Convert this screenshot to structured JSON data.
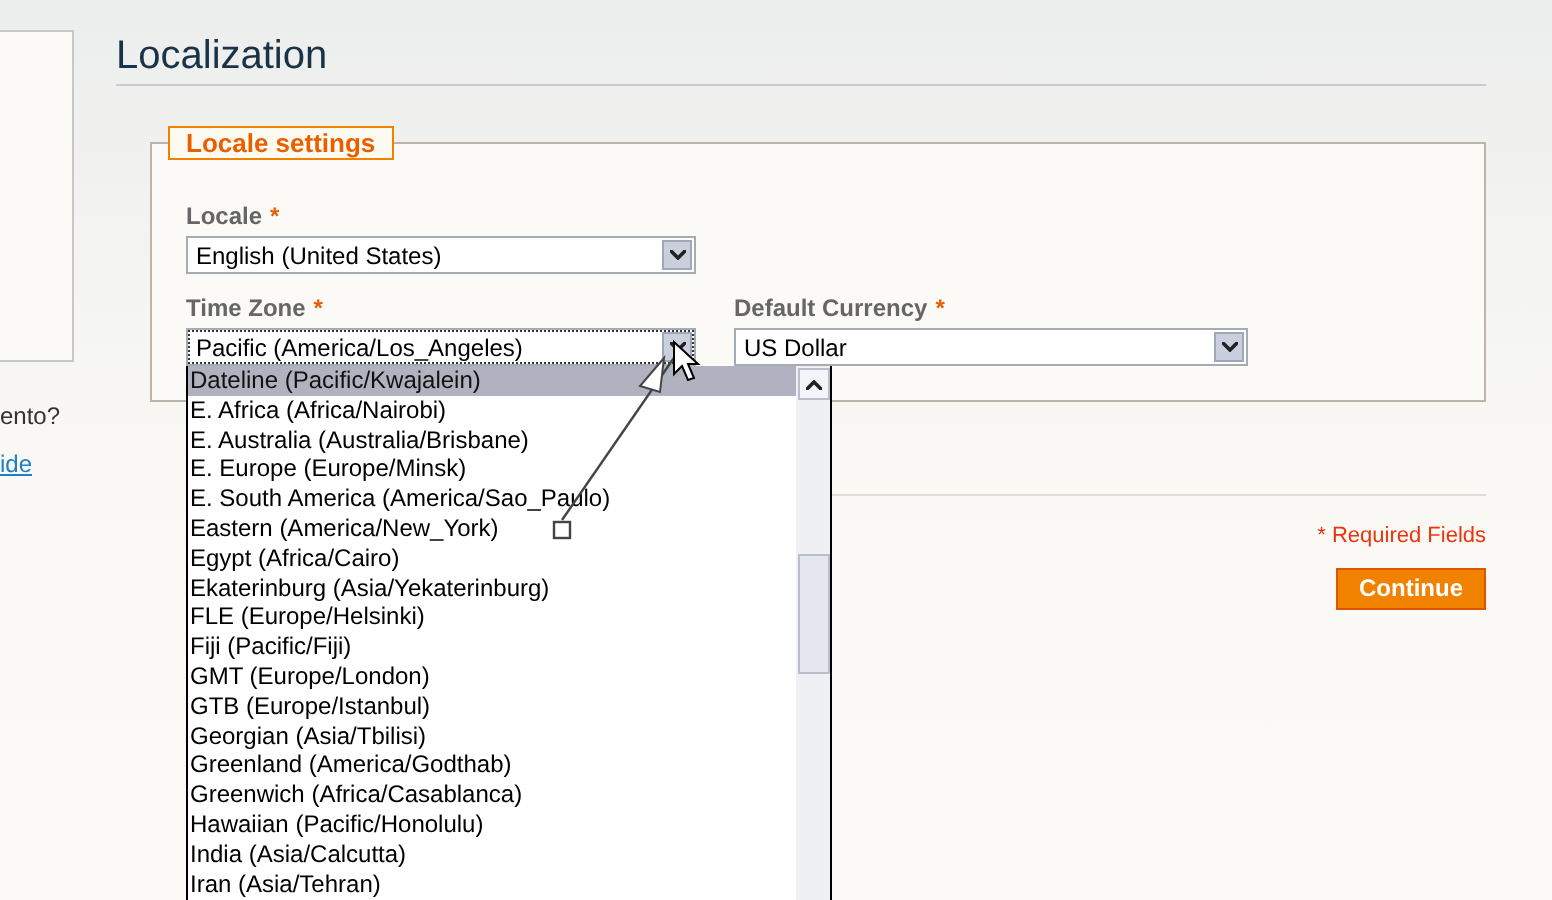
{
  "sidebar": {
    "texts": [
      {
        "text": "ento?",
        "kind": "text"
      },
      {
        "text": "ide",
        "kind": "link"
      }
    ]
  },
  "page": {
    "title": "Localization"
  },
  "fieldset": {
    "legend": "Locale settings",
    "fields": [
      {
        "label": "Locale",
        "mark": "*",
        "value": "English (United States)",
        "expanded": false
      },
      {
        "label": "Time Zone",
        "mark": "*",
        "value": "Pacific (America/Los_Angeles)",
        "expanded": true,
        "options": [
          {
            "label": "Dateline (Pacific/Kwajalein)",
            "selected": true
          },
          {
            "label": "E. Africa (Africa/Nairobi)",
            "selected": false
          },
          {
            "label": "E. Australia (Australia/Brisbane)",
            "selected": false
          },
          {
            "label": "E. Europe (Europe/Minsk)",
            "selected": false
          },
          {
            "label": "E. South America (America/Sao_Paulo)",
            "selected": false
          },
          {
            "label": "Eastern (America/New_York)",
            "selected": false
          },
          {
            "label": "Egypt (Africa/Cairo)",
            "selected": false
          },
          {
            "label": "Ekaterinburg (Asia/Yekaterinburg)",
            "selected": false
          },
          {
            "label": "FLE (Europe/Helsinki)",
            "selected": false
          },
          {
            "label": "Fiji (Pacific/Fiji)",
            "selected": false
          },
          {
            "label": "GMT (Europe/London)",
            "selected": false
          },
          {
            "label": "GTB (Europe/Istanbul)",
            "selected": false
          },
          {
            "label": "Georgian (Asia/Tbilisi)",
            "selected": false
          },
          {
            "label": "Greenland (America/Godthab)",
            "selected": false
          },
          {
            "label": "Greenwich (Africa/Casablanca)",
            "selected": false
          },
          {
            "label": "Hawaiian (Pacific/Honolulu)",
            "selected": false
          },
          {
            "label": "India (Asia/Calcutta)",
            "selected": false
          },
          {
            "label": "Iran (Asia/Tehran)",
            "selected": false
          }
        ]
      },
      {
        "label": "Default Currency",
        "mark": "*",
        "value": "US Dollar",
        "expanded": false
      }
    ]
  },
  "footer": {
    "required_note": "* Required Fields",
    "button": "Continue"
  }
}
